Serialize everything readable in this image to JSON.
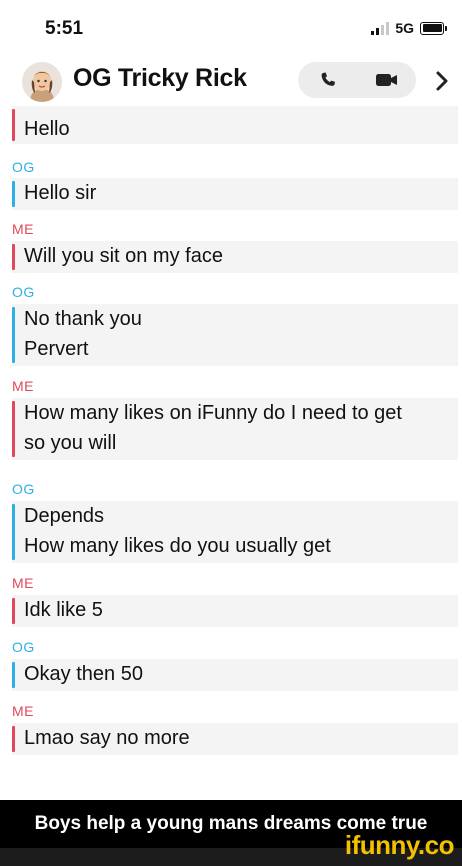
{
  "status_bar": {
    "time": "5:51",
    "network": "5G"
  },
  "header": {
    "title": "OG Tricky Rick",
    "icons": [
      "avatar",
      "phone-icon",
      "video-camera-icon",
      "chevron-right-icon"
    ]
  },
  "messages": [
    {
      "sender": "",
      "side": "me",
      "lines": [
        "Hello"
      ]
    },
    {
      "sender": "OG",
      "side": "og",
      "lines": [
        "Hello sir"
      ]
    },
    {
      "sender": "ME",
      "side": "me",
      "lines": [
        "Will you sit on my face"
      ]
    },
    {
      "sender": "OG",
      "side": "og",
      "lines": [
        "No thank you",
        "Pervert"
      ]
    },
    {
      "sender": "ME",
      "side": "me",
      "lines": [
        "How many likes on iFunny do I need to get",
        "so you will"
      ]
    },
    {
      "sender": "OG",
      "side": "og",
      "lines": [
        "Depends",
        "How many likes do you usually get"
      ]
    },
    {
      "sender": "ME",
      "side": "me",
      "lines": [
        "Idk like 5"
      ]
    },
    {
      "sender": "OG",
      "side": "og",
      "lines": [
        "Okay then 50"
      ]
    },
    {
      "sender": "ME",
      "side": "me",
      "lines": [
        "Lmao say no more"
      ]
    }
  ],
  "caption": "Boys help a young mans dreams come true",
  "watermark": "ifunny.co",
  "colors": {
    "me": "#e0495c",
    "og": "#2fb0e4",
    "bubble": "#f4f4f4",
    "watermark": "#f2c200"
  }
}
